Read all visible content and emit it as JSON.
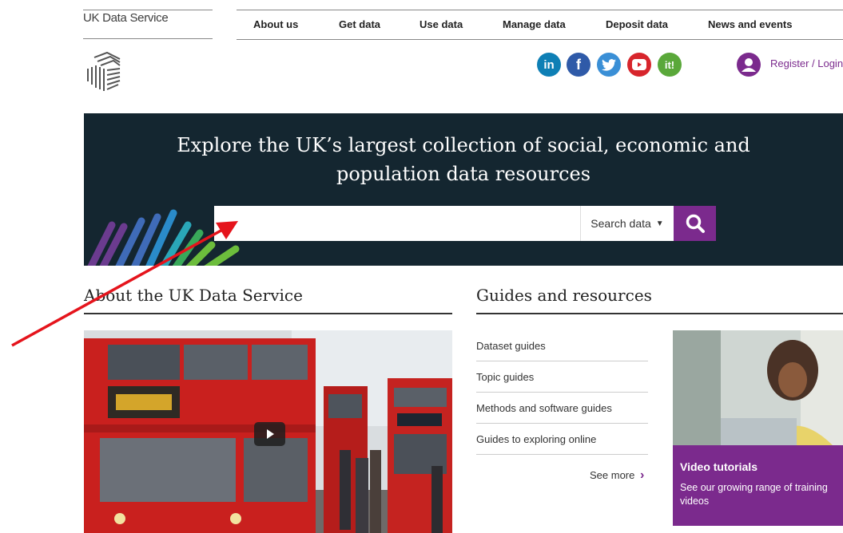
{
  "brand": {
    "name": "UK Data Service"
  },
  "nav": {
    "items": [
      {
        "label": "About us"
      },
      {
        "label": "Get data"
      },
      {
        "label": "Use data"
      },
      {
        "label": "Manage data"
      },
      {
        "label": "Deposit data"
      },
      {
        "label": "News and events"
      }
    ]
  },
  "social": {
    "icons": [
      "linkedin-icon",
      "facebook-icon",
      "twitter-icon",
      "youtube-icon",
      "it-icon"
    ],
    "linkedin_label": "in",
    "facebook_label": "f",
    "it_label": "it!"
  },
  "account": {
    "label": "Register / Login"
  },
  "hero": {
    "title": "Explore the UK’s largest collection of social, economic and population data resources",
    "search_value": "",
    "search_select": "Search data"
  },
  "about": {
    "title": "About the UK Data Service"
  },
  "guides": {
    "title": "Guides and resources",
    "items": [
      {
        "label": "Dataset guides"
      },
      {
        "label": "Topic guides"
      },
      {
        "label": "Methods and software guides"
      },
      {
        "label": "Guides to exploring online"
      }
    ],
    "see_more": "See more"
  },
  "video": {
    "title": "Video tutorials",
    "description": "See our growing range of training videos"
  },
  "colors": {
    "accent_purple": "#7b2a8d",
    "hero_bg": "#142630",
    "annotation_red": "#e5141c"
  }
}
